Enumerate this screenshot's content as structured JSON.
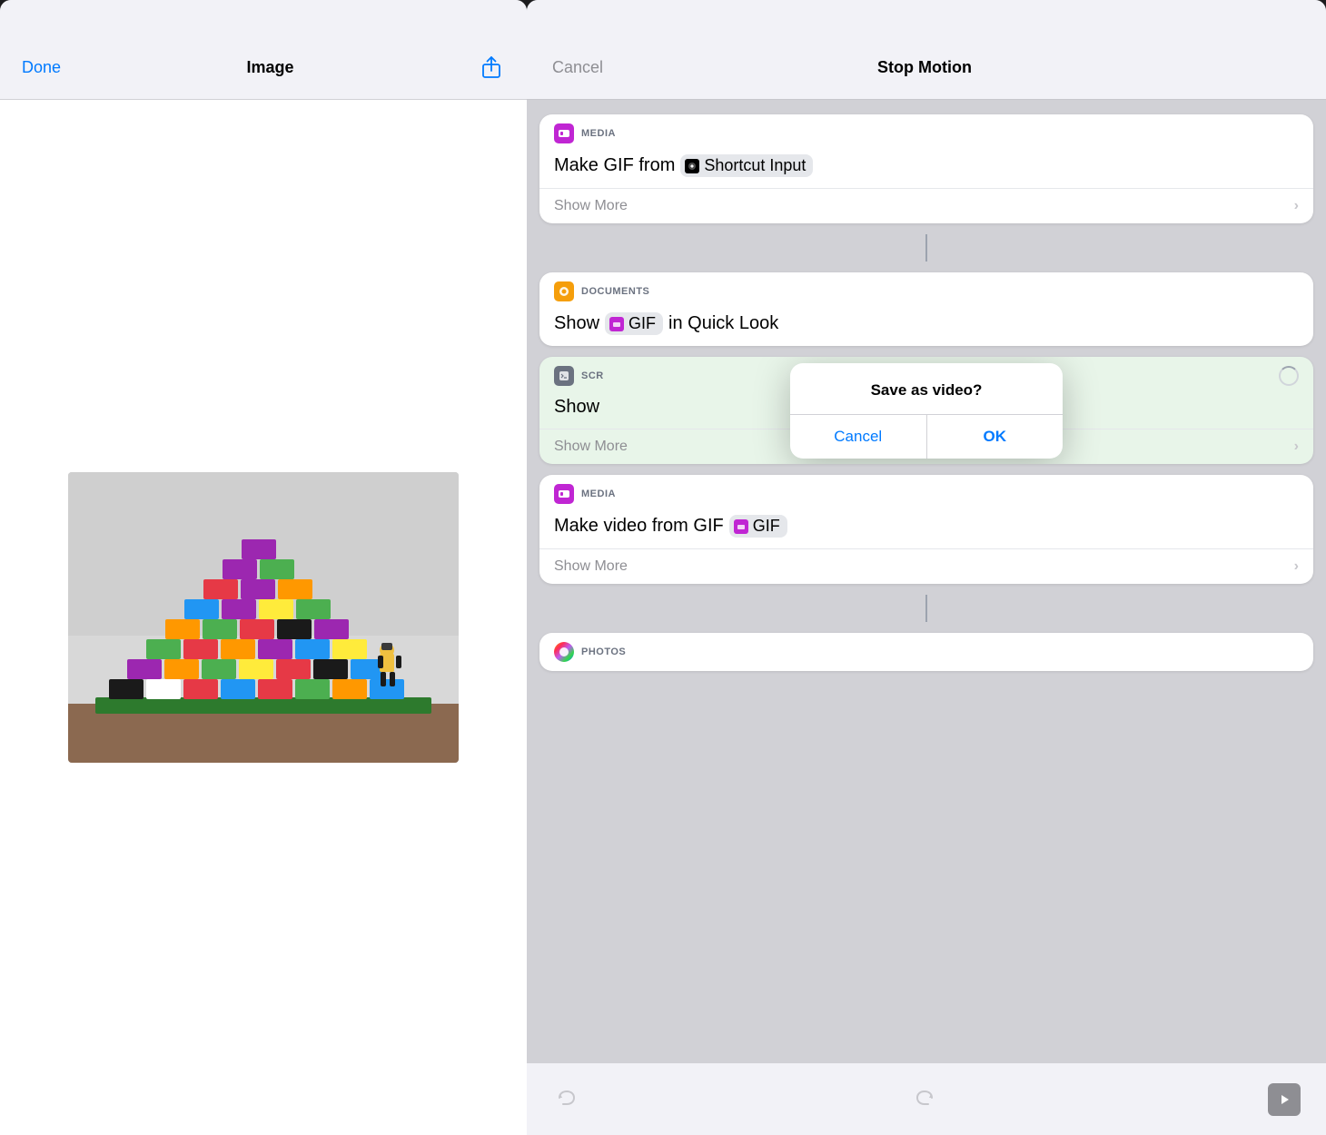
{
  "left": {
    "done_label": "Done",
    "title": "Image",
    "share_icon": "↑"
  },
  "right": {
    "cancel_label": "Cancel",
    "title": "Stop Motion",
    "cards": [
      {
        "id": "make-gif",
        "category_icon": "media",
        "category_label": "MEDIA",
        "body_prefix": "Make GIF from",
        "pill_icon": "shortcut",
        "pill_label": "Shortcut Input",
        "show_more": "Show More",
        "has_spinner": false,
        "tint": "none"
      },
      {
        "id": "show-gif",
        "category_icon": "docs",
        "category_label": "DOCUMENTS",
        "body_prefix": "Show",
        "pill_icon": "gif-media",
        "pill_label": "GIF",
        "body_suffix": "in Quick Look",
        "show_more": null,
        "has_spinner": false,
        "tint": "none"
      },
      {
        "id": "screenshot",
        "category_icon": "scripts",
        "category_label": "SCR",
        "body_prefix": "Show",
        "show_more": "Show More",
        "has_spinner": true,
        "tint": "green"
      },
      {
        "id": "make-video",
        "category_icon": "media",
        "category_label": "MEDIA",
        "body_prefix": "Make video from GIF",
        "pill_icon": "gif-media",
        "pill_label": "GIF",
        "show_more": "Show More",
        "has_spinner": false,
        "tint": "none"
      }
    ],
    "alert": {
      "title": "Save as video?",
      "cancel_label": "Cancel",
      "ok_label": "OK"
    },
    "bottom": {
      "undo_icon": "↩",
      "redo_icon": "↪",
      "play_icon": "▶"
    },
    "photos_label": "PHOTOS"
  }
}
